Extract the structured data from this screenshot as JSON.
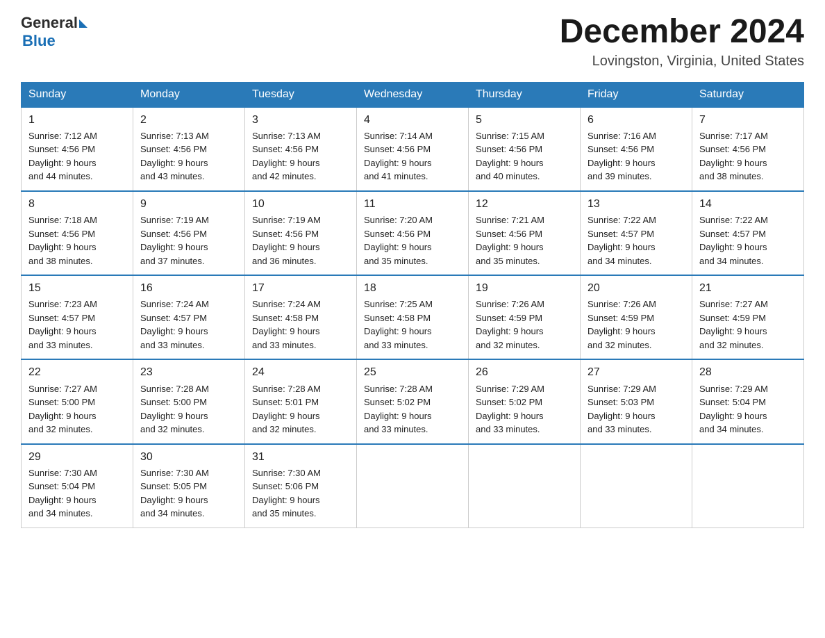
{
  "header": {
    "logo_general": "General",
    "logo_blue": "Blue",
    "month_title": "December 2024",
    "location": "Lovingston, Virginia, United States"
  },
  "weekdays": [
    "Sunday",
    "Monday",
    "Tuesday",
    "Wednesday",
    "Thursday",
    "Friday",
    "Saturday"
  ],
  "weeks": [
    [
      {
        "day": "1",
        "sunrise": "7:12 AM",
        "sunset": "4:56 PM",
        "daylight": "9 hours and 44 minutes."
      },
      {
        "day": "2",
        "sunrise": "7:13 AM",
        "sunset": "4:56 PM",
        "daylight": "9 hours and 43 minutes."
      },
      {
        "day": "3",
        "sunrise": "7:13 AM",
        "sunset": "4:56 PM",
        "daylight": "9 hours and 42 minutes."
      },
      {
        "day": "4",
        "sunrise": "7:14 AM",
        "sunset": "4:56 PM",
        "daylight": "9 hours and 41 minutes."
      },
      {
        "day": "5",
        "sunrise": "7:15 AM",
        "sunset": "4:56 PM",
        "daylight": "9 hours and 40 minutes."
      },
      {
        "day": "6",
        "sunrise": "7:16 AM",
        "sunset": "4:56 PM",
        "daylight": "9 hours and 39 minutes."
      },
      {
        "day": "7",
        "sunrise": "7:17 AM",
        "sunset": "4:56 PM",
        "daylight": "9 hours and 38 minutes."
      }
    ],
    [
      {
        "day": "8",
        "sunrise": "7:18 AM",
        "sunset": "4:56 PM",
        "daylight": "9 hours and 38 minutes."
      },
      {
        "day": "9",
        "sunrise": "7:19 AM",
        "sunset": "4:56 PM",
        "daylight": "9 hours and 37 minutes."
      },
      {
        "day": "10",
        "sunrise": "7:19 AM",
        "sunset": "4:56 PM",
        "daylight": "9 hours and 36 minutes."
      },
      {
        "day": "11",
        "sunrise": "7:20 AM",
        "sunset": "4:56 PM",
        "daylight": "9 hours and 35 minutes."
      },
      {
        "day": "12",
        "sunrise": "7:21 AM",
        "sunset": "4:56 PM",
        "daylight": "9 hours and 35 minutes."
      },
      {
        "day": "13",
        "sunrise": "7:22 AM",
        "sunset": "4:57 PM",
        "daylight": "9 hours and 34 minutes."
      },
      {
        "day": "14",
        "sunrise": "7:22 AM",
        "sunset": "4:57 PM",
        "daylight": "9 hours and 34 minutes."
      }
    ],
    [
      {
        "day": "15",
        "sunrise": "7:23 AM",
        "sunset": "4:57 PM",
        "daylight": "9 hours and 33 minutes."
      },
      {
        "day": "16",
        "sunrise": "7:24 AM",
        "sunset": "4:57 PM",
        "daylight": "9 hours and 33 minutes."
      },
      {
        "day": "17",
        "sunrise": "7:24 AM",
        "sunset": "4:58 PM",
        "daylight": "9 hours and 33 minutes."
      },
      {
        "day": "18",
        "sunrise": "7:25 AM",
        "sunset": "4:58 PM",
        "daylight": "9 hours and 33 minutes."
      },
      {
        "day": "19",
        "sunrise": "7:26 AM",
        "sunset": "4:59 PM",
        "daylight": "9 hours and 32 minutes."
      },
      {
        "day": "20",
        "sunrise": "7:26 AM",
        "sunset": "4:59 PM",
        "daylight": "9 hours and 32 minutes."
      },
      {
        "day": "21",
        "sunrise": "7:27 AM",
        "sunset": "4:59 PM",
        "daylight": "9 hours and 32 minutes."
      }
    ],
    [
      {
        "day": "22",
        "sunrise": "7:27 AM",
        "sunset": "5:00 PM",
        "daylight": "9 hours and 32 minutes."
      },
      {
        "day": "23",
        "sunrise": "7:28 AM",
        "sunset": "5:00 PM",
        "daylight": "9 hours and 32 minutes."
      },
      {
        "day": "24",
        "sunrise": "7:28 AM",
        "sunset": "5:01 PM",
        "daylight": "9 hours and 32 minutes."
      },
      {
        "day": "25",
        "sunrise": "7:28 AM",
        "sunset": "5:02 PM",
        "daylight": "9 hours and 33 minutes."
      },
      {
        "day": "26",
        "sunrise": "7:29 AM",
        "sunset": "5:02 PM",
        "daylight": "9 hours and 33 minutes."
      },
      {
        "day": "27",
        "sunrise": "7:29 AM",
        "sunset": "5:03 PM",
        "daylight": "9 hours and 33 minutes."
      },
      {
        "day": "28",
        "sunrise": "7:29 AM",
        "sunset": "5:04 PM",
        "daylight": "9 hours and 34 minutes."
      }
    ],
    [
      {
        "day": "29",
        "sunrise": "7:30 AM",
        "sunset": "5:04 PM",
        "daylight": "9 hours and 34 minutes."
      },
      {
        "day": "30",
        "sunrise": "7:30 AM",
        "sunset": "5:05 PM",
        "daylight": "9 hours and 34 minutes."
      },
      {
        "day": "31",
        "sunrise": "7:30 AM",
        "sunset": "5:06 PM",
        "daylight": "9 hours and 35 minutes."
      },
      null,
      null,
      null,
      null
    ]
  ],
  "labels": {
    "sunrise": "Sunrise:",
    "sunset": "Sunset:",
    "daylight": "Daylight:"
  }
}
